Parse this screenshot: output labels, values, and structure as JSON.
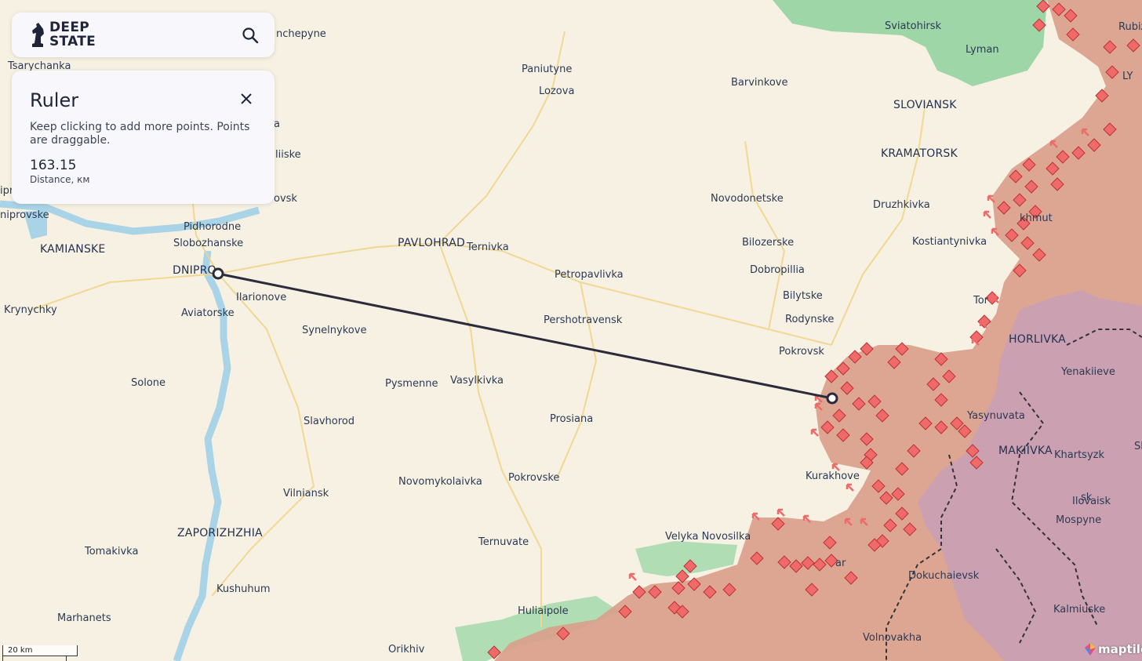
{
  "brand": {
    "line1": "DEEP",
    "line2": "STATE"
  },
  "icons": {
    "logo": "knight-icon",
    "search": "search-icon",
    "close": "close-icon"
  },
  "ruler": {
    "title": "Ruler",
    "hint": "Keep clicking to add more points. Points are draggable.",
    "distance": "163.15",
    "distance_label": "Distance, км"
  },
  "scale": {
    "label": "20 km"
  },
  "attribution": "maptiler",
  "colors": {
    "occupied": "#d9a08c",
    "annexed": "#c9a0b4",
    "liberated": "#8fd19e",
    "ruler_line": "#2b2b3c",
    "marker": "#f06a6a"
  },
  "labels": [
    {
      "text": "Tsarychanka",
      "cls": "lbl"
    },
    {
      "text": "nchepyne",
      "cls": "lbl"
    },
    {
      "text": "Paniutyne",
      "cls": "lbl"
    },
    {
      "text": "Lozova",
      "cls": "lbl"
    },
    {
      "text": "Barvinkove",
      "cls": "lbl"
    },
    {
      "text": "Sviatohirsk",
      "cls": "lbl"
    },
    {
      "text": "Lyman",
      "cls": "lbl"
    },
    {
      "text": "Rubiz",
      "cls": "lbl"
    },
    {
      "text": "LY",
      "cls": "lbl"
    },
    {
      "text": "SLOVIANSK",
      "cls": "city"
    },
    {
      "text": "KRAMATORSK",
      "cls": "city"
    },
    {
      "text": "Druzhkivka",
      "cls": "lbl"
    },
    {
      "text": "Novodonetske",
      "cls": "lbl"
    },
    {
      "text": "Kostiantynivka",
      "cls": "lbl"
    },
    {
      "text": "khmut",
      "cls": "lbl"
    },
    {
      "text": "Bilozerske",
      "cls": "lbl"
    },
    {
      "text": "Dobropillia",
      "cls": "lbl"
    },
    {
      "text": "Bilytske",
      "cls": "lbl"
    },
    {
      "text": "Rodynske",
      "cls": "lbl"
    },
    {
      "text": "Pokrovsk",
      "cls": "lbl"
    },
    {
      "text": "HORLIVKA",
      "cls": "city"
    },
    {
      "text": "Yenakiieve",
      "cls": "lbl"
    },
    {
      "text": "Yasynuvata",
      "cls": "lbl"
    },
    {
      "text": "MAKIIVKA",
      "cls": "city"
    },
    {
      "text": "Khartsyzk",
      "cls": "lbl"
    },
    {
      "text": "Ilovaisk",
      "cls": "lbl"
    },
    {
      "text": "Mospyne",
      "cls": "lbl"
    },
    {
      "text": "Dokuchaievsk",
      "cls": "lbl"
    },
    {
      "text": "Kalmiuske",
      "cls": "lbl"
    },
    {
      "text": "Volnovakha",
      "cls": "lbl"
    },
    {
      "text": "Kurakhove",
      "cls": "lbl"
    },
    {
      "text": "Velyka Novosilka",
      "cls": "lbl"
    },
    {
      "text": "Huliaipole",
      "cls": "lbl"
    },
    {
      "text": "Orikhiv",
      "cls": "lbl"
    },
    {
      "text": "Ternuvate",
      "cls": "lbl"
    },
    {
      "text": "Pokrovske",
      "cls": "lbl"
    },
    {
      "text": "Novomykolaivka",
      "cls": "lbl"
    },
    {
      "text": "Prosiana",
      "cls": "lbl"
    },
    {
      "text": "Vasylkivka",
      "cls": "lbl"
    },
    {
      "text": "Pysmenne",
      "cls": "lbl"
    },
    {
      "text": "Pershotravensk",
      "cls": "lbl"
    },
    {
      "text": "Petropavlivka",
      "cls": "lbl"
    },
    {
      "text": "PAVLOHRAD",
      "cls": "city"
    },
    {
      "text": "Ternivka",
      "cls": "lbl"
    },
    {
      "text": "Synelnykove",
      "cls": "lbl"
    },
    {
      "text": "Slavhorod",
      "cls": "lbl"
    },
    {
      "text": "Vilniansk",
      "cls": "lbl"
    },
    {
      "text": "ZAPORIZHZHIA",
      "cls": "city"
    },
    {
      "text": "Kushuhum",
      "cls": "lbl"
    },
    {
      "text": "Tomakivka",
      "cls": "lbl"
    },
    {
      "text": "Marhanets",
      "cls": "lbl"
    },
    {
      "text": "Solone",
      "cls": "lbl"
    },
    {
      "text": "Krynychky",
      "cls": "lbl"
    },
    {
      "text": "Aviatorske",
      "cls": "lbl"
    },
    {
      "text": "Ilarionove",
      "cls": "lbl"
    },
    {
      "text": "DNIPRO",
      "cls": "city"
    },
    {
      "text": "KAMIANSKE",
      "cls": "city"
    },
    {
      "text": "Slobozhanske",
      "cls": "lbl"
    },
    {
      "text": "Pidhorodne",
      "cls": "lbl"
    },
    {
      "text": "niprovske",
      "cls": "lbl"
    },
    {
      "text": "ovsk",
      "cls": "lbl"
    },
    {
      "text": "liiske",
      "cls": "lbl"
    },
    {
      "text": "a",
      "cls": "lbl"
    },
    {
      "text": "ipr",
      "cls": "lbl"
    },
    {
      "text": "Tor",
      "cls": "lbl"
    },
    {
      "text": "Sl",
      "cls": "lbl"
    },
    {
      "text": "sk",
      "cls": "lbl"
    },
    {
      "text": "ar",
      "cls": "lbl"
    }
  ]
}
